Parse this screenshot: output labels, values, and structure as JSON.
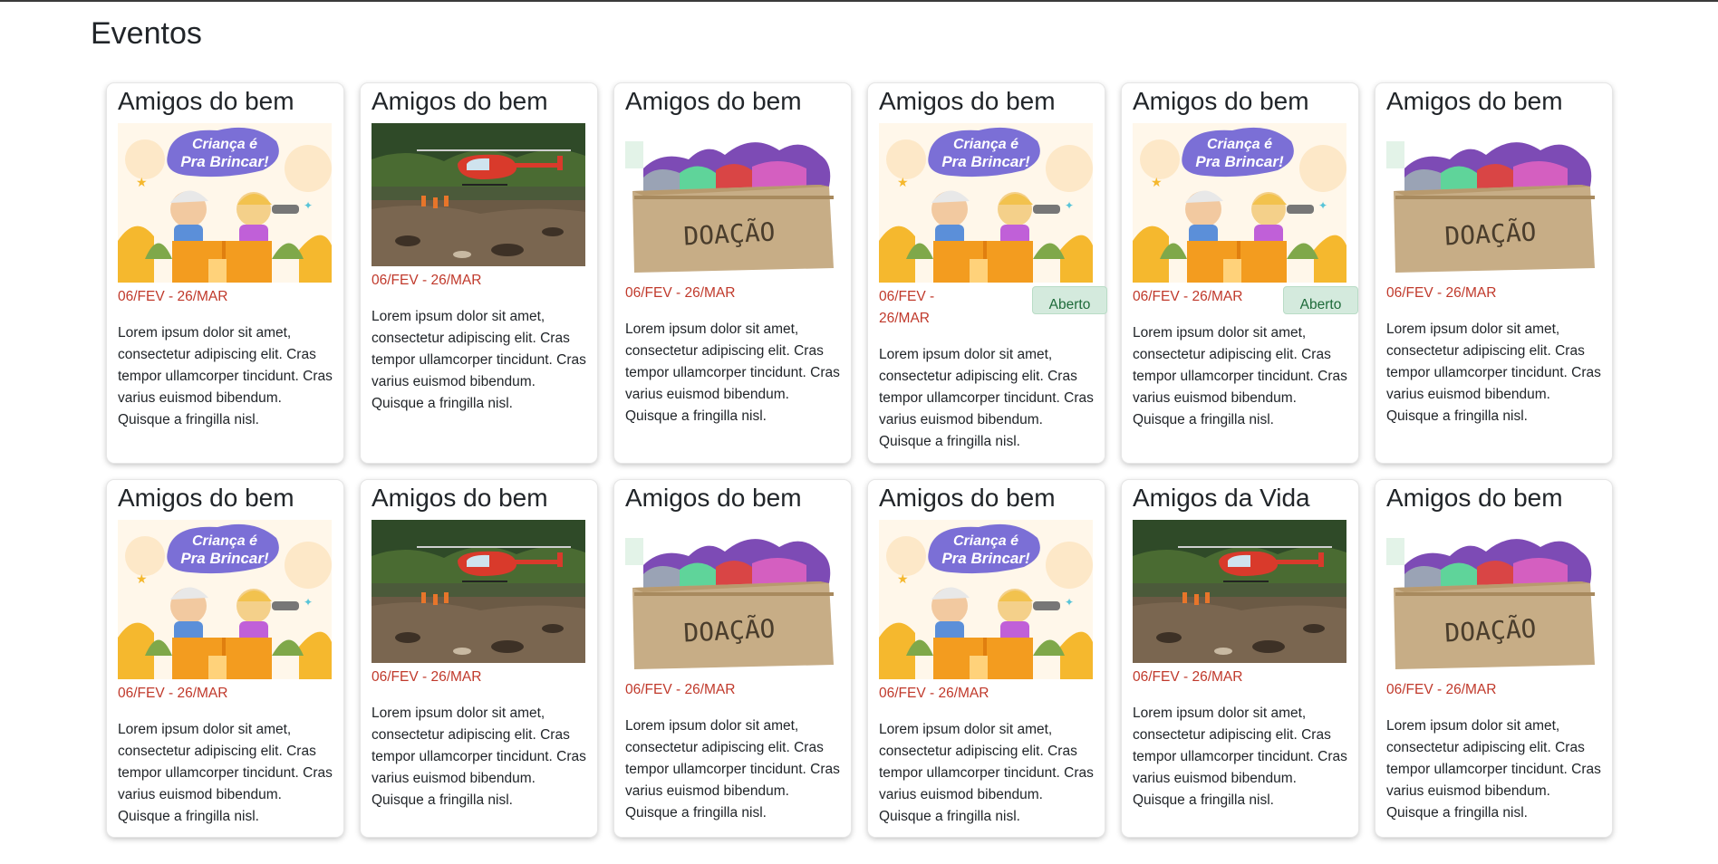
{
  "page": {
    "title": "Eventos"
  },
  "status_label": "Aberto",
  "cards": [
    {
      "title": "Amigos do bem",
      "image": "kids-banner",
      "date": "06/FEV - 26/MAR",
      "text": "Lorem ipsum dolor sit amet, consectetur adipiscing elit. Cras tempor ullamcorper tincidunt. Cras varius euismod bibendum. Quisque a fringilla nisl."
    },
    {
      "title": "Amigos do bem",
      "image": "rescue-helicopter-photo",
      "date": "06/FEV - 26/MAR",
      "text": "Lorem ipsum dolor sit amet, consectetur adipiscing elit. Cras tempor ullamcorper tincidunt. Cras varius euismod bibendum. Quisque a fringilla nisl."
    },
    {
      "title": "Amigos do bem",
      "image": "donation-box-photo",
      "date": "06/FEV - 26/MAR",
      "text": "Lorem ipsum dolor sit amet, consectetur adipiscing elit. Cras tempor ullamcorper tincidunt. Cras varius euismod bibendum. Quisque a fringilla nisl."
    },
    {
      "title": "Amigos do bem",
      "image": "kids-banner",
      "date": "06/FEV - 26/MAR",
      "status": "Aberto",
      "text": "Lorem ipsum dolor sit amet, consectetur adipiscing elit. Cras tempor ullamcorper tincidunt. Cras varius euismod bibendum. Quisque a fringilla nisl."
    },
    {
      "title": "Amigos do bem",
      "image": "kids-banner",
      "date": "06/FEV - 26/MAR",
      "status": "Aberto",
      "text": "Lorem ipsum dolor sit amet, consectetur adipiscing elit. Cras tempor ullamcorper tincidunt. Cras varius euismod bibendum. Quisque a fringilla nisl."
    },
    {
      "title": "Amigos do bem",
      "image": "donation-box-photo",
      "date": "06/FEV - 26/MAR",
      "text": "Lorem ipsum dolor sit amet, consectetur adipiscing elit. Cras tempor ullamcorper tincidunt. Cras varius euismod bibendum. Quisque a fringilla nisl."
    },
    {
      "title": "Amigos do bem",
      "image": "kids-banner",
      "date": "06/FEV - 26/MAR",
      "text": "Lorem ipsum dolor sit amet, consectetur adipiscing elit. Cras tempor ullamcorper tincidunt. Cras varius euismod bibendum. Quisque a fringilla nisl."
    },
    {
      "title": "Amigos do bem",
      "image": "rescue-helicopter-photo",
      "date": "06/FEV - 26/MAR",
      "text": "Lorem ipsum dolor sit amet, consectetur adipiscing elit. Cras tempor ullamcorper tincidunt. Cras varius euismod bibendum. Quisque a fringilla nisl."
    },
    {
      "title": "Amigos do bem",
      "image": "donation-box-photo",
      "date": "06/FEV - 26/MAR",
      "text": "Lorem ipsum dolor sit amet, consectetur adipiscing elit. Cras tempor ullamcorper tincidunt. Cras varius euismod bibendum. Quisque a fringilla nisl."
    },
    {
      "title": "Amigos do bem",
      "image": "kids-banner",
      "date": "06/FEV - 26/MAR",
      "text": "Lorem ipsum dolor sit amet, consectetur adipiscing elit. Cras tempor ullamcorper tincidunt. Cras varius euismod bibendum. Quisque a fringilla nisl."
    },
    {
      "title": "Amigos da Vida",
      "image": "rescue-helicopter-photo",
      "date": "06/FEV - 26/MAR",
      "text": "Lorem ipsum dolor sit amet, consectetur adipiscing elit. Cras tempor ullamcorper tincidunt. Cras varius euismod bibendum. Quisque a fringilla nisl."
    },
    {
      "title": "Amigos do bem",
      "image": "donation-box-photo",
      "date": "06/FEV - 26/MAR",
      "text": "Lorem ipsum dolor sit amet, consectetur adipiscing elit. Cras tempor ullamcorper tincidunt. Cras varius euismod bibendum. Quisque a fringilla nisl."
    }
  ],
  "banner_lettering": {
    "line1": "Criança é",
    "line2": "Pra Brincar!"
  },
  "box_lettering": "DOAÇÃO",
  "colors": {
    "date": "#c0392b",
    "badge_bg": "#d4eadd",
    "badge_text": "#1e6b3a"
  }
}
